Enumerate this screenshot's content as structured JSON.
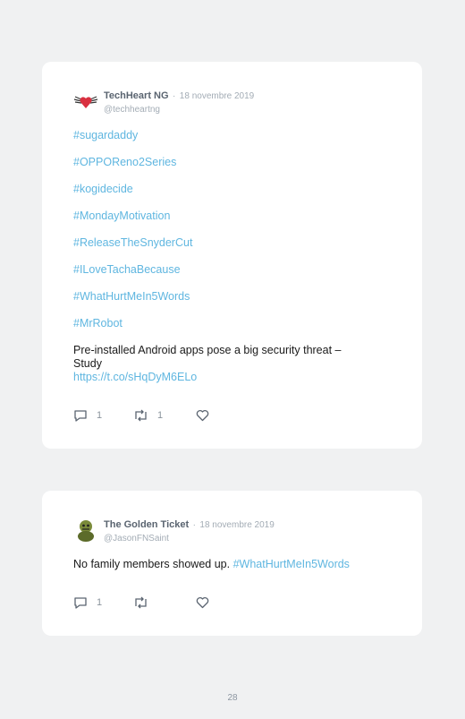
{
  "tweets": [
    {
      "author": "TechHeart NG",
      "separator": "·",
      "date": "18 novembre 2019",
      "handle": "@techheartng",
      "hashtags": [
        "#sugardaddy",
        "#OPPOReno2Series",
        "#kogidecide",
        "#MondayMotivation",
        "#ReleaseTheSnyderCut",
        "#ILoveTachaBecause",
        "#WhatHurtMeIn5Words",
        "#MrRobot"
      ],
      "text_line1": "Pre-installed Android apps pose a big security threat –",
      "text_line2": "Study",
      "link": "https://t.co/sHqDyM6ELo",
      "replies": "1",
      "retweets": "1",
      "likes": ""
    },
    {
      "author": "The Golden Ticket",
      "separator": "·",
      "date": "18 novembre 2019",
      "handle": "@JasonFNSaint",
      "text": "No family members showed up.",
      "hashtag": "#WhatHurtMeIn5Words",
      "replies": "1",
      "retweets": "",
      "likes": ""
    }
  ],
  "page_number": "28",
  "colors": {
    "background": "#f0f1f2",
    "card": "#ffffff",
    "link": "#5fb6e0",
    "meta": "#a3acb5"
  },
  "icons": [
    "reply-icon",
    "retweet-icon",
    "like-icon"
  ]
}
